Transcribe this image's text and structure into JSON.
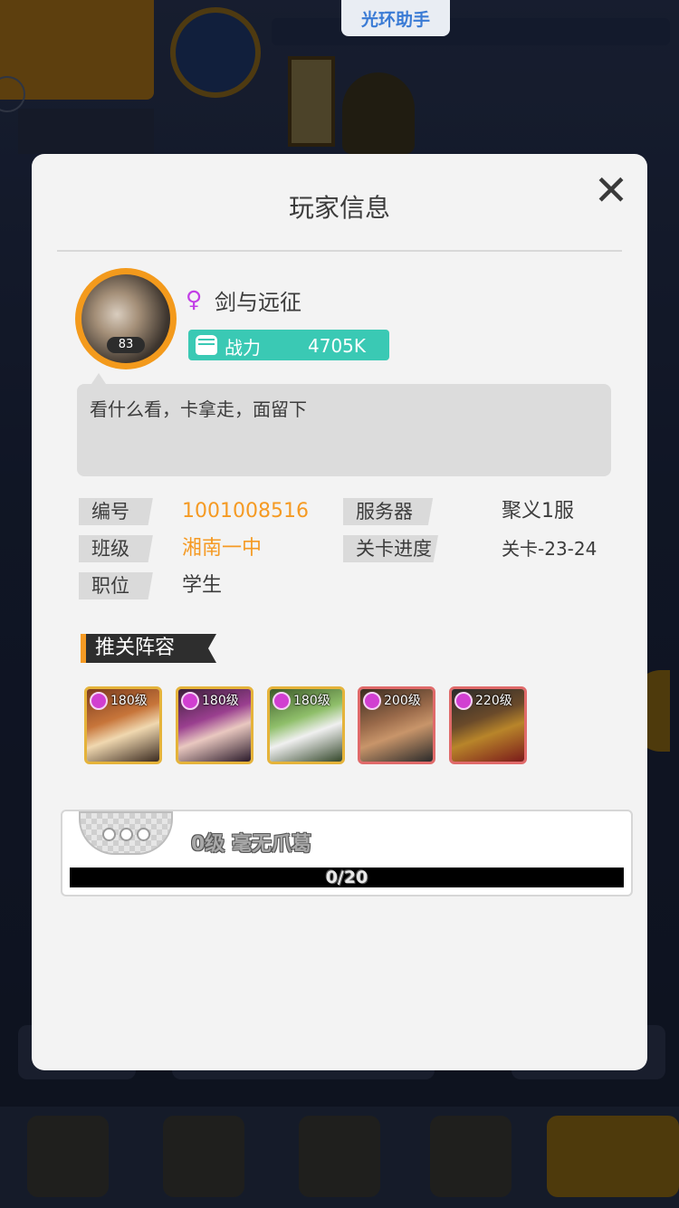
{
  "assistant_badge": "光环助手",
  "dialog": {
    "title": "玩家信息",
    "close_symbol": "✕"
  },
  "player": {
    "avatar_level": "83",
    "gender_symbol": "♀",
    "name": "剑与远征",
    "power_label": "战力",
    "power_value": "4705K",
    "signature": "看什么看，卡拿走，面留下"
  },
  "info": {
    "id_label": "编号",
    "id_value": "1001008516",
    "server_label": "服务器",
    "server_value": "聚义1服",
    "class_label": "班级",
    "class_value": "湘南一中",
    "stage_label": "关卡进度",
    "stage_value": "关卡-23-24",
    "job_label": "职位",
    "job_value": "学生"
  },
  "lineup": {
    "title": "推关阵容",
    "heroes": [
      {
        "level": "180级",
        "frame_color": "#e5b33a"
      },
      {
        "level": "180级",
        "frame_color": "#e5b33a"
      },
      {
        "level": "180级",
        "frame_color": "#e5b33a"
      },
      {
        "level": "200级",
        "frame_color": "#e06a6a"
      },
      {
        "level": "220级",
        "frame_color": "#e06a6a"
      }
    ]
  },
  "rank": {
    "name": "0级 毫无爪葛",
    "progress_text": "0/20",
    "progress_fraction": 0
  },
  "colors": {
    "accent_orange": "#f59a23",
    "power_teal": "#3ac9b4",
    "gender_purple": "#c23ee6"
  }
}
